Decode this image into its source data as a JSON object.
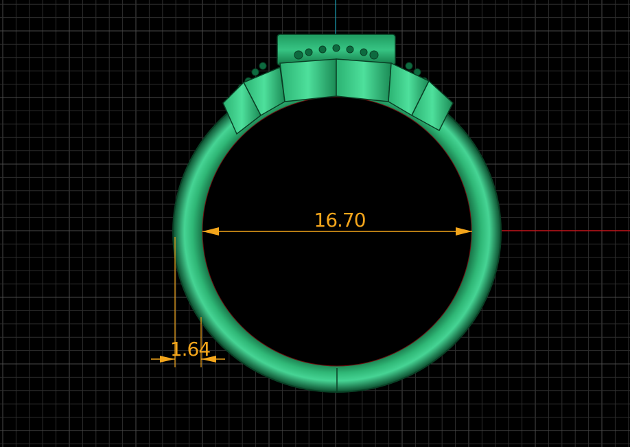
{
  "colors": {
    "background": "#000000",
    "grid_minor": "#2e2e2e",
    "grid_major": "#4a4a4a",
    "axis_vertical": "#1aa0b4",
    "axis_horizontal": "#c4141a",
    "dimension": "#f3a51b",
    "ring_dark": "#0a4a2c",
    "ring_mid": "#1a8a55",
    "ring_light": "#3ed08c"
  },
  "dimensions": {
    "inner_diameter": "16.70",
    "shank_thickness": "1.64"
  }
}
